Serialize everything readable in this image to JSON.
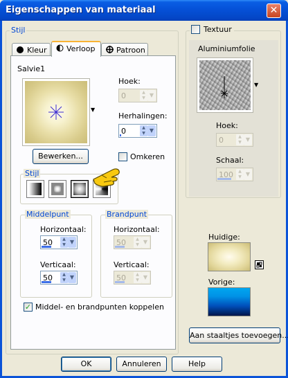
{
  "window": {
    "title": "Eigenschappen van materiaal",
    "close": "✕"
  },
  "stijl_group": {
    "label": "Stijl"
  },
  "tabs": [
    {
      "label": "Kleur",
      "active": false
    },
    {
      "label": "Verloop",
      "active": true
    },
    {
      "label": "Patroon",
      "active": false
    }
  ],
  "gradient": {
    "name": "Salvie1",
    "edit_button": "Bewerken...",
    "reverse_label": "Omkeren",
    "reverse_checked": false,
    "angle_label": "Hoek:",
    "angle_value": "0",
    "repeats_label": "Herhalingen:",
    "repeats_value": "0",
    "style_group_label": "Stijl",
    "styles": [
      "linear",
      "rectangular",
      "sunburst",
      "radial"
    ],
    "selected_style": "sunburst"
  },
  "middelpunt": {
    "label": "Middelpunt",
    "h_label": "Horizontaal:",
    "h_value": "50",
    "v_label": "Verticaal:",
    "v_value": "50"
  },
  "brandpunt": {
    "label": "Brandpunt",
    "h_label": "Horizontaal:",
    "h_value": "50",
    "v_label": "Verticaal:",
    "v_value": "50"
  },
  "link_checkbox": {
    "label": "Middel- en brandpunten koppelen",
    "checked": true
  },
  "texture": {
    "label": "Textuur",
    "checked": false,
    "name": "Aluminiumfolie",
    "angle_label": "Hoek:",
    "angle_value": "0",
    "scale_label": "Schaal:",
    "scale_value": "100"
  },
  "current": {
    "label": "Huidige:"
  },
  "previous": {
    "label": "Vorige:"
  },
  "add_swatch_button": "Aan staaltjes toevoegen...",
  "footer": {
    "ok": "OK",
    "cancel": "Annuleren",
    "help": "Help"
  },
  "colors": {
    "accent": "#0a53d8",
    "gradient_center": "#fffbee",
    "gradient_ring": "#e9dfa9",
    "previous_top": "#00a6f0",
    "previous_bottom": "#00154a"
  }
}
